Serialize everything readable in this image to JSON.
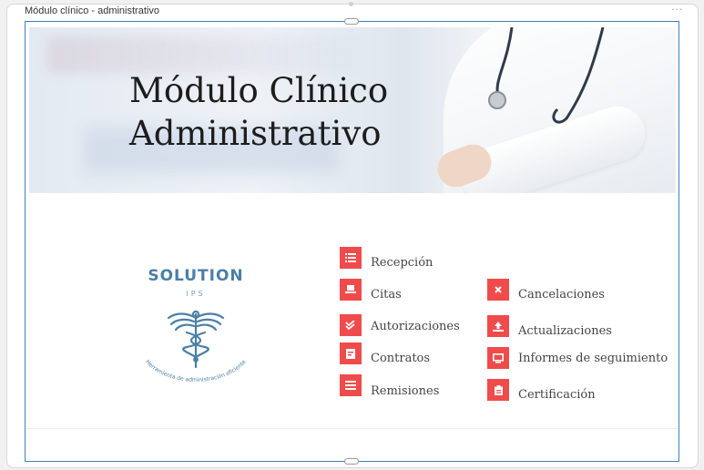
{
  "window": {
    "title": "Módulo clínico - administrativo",
    "more_glyph": "···"
  },
  "banner": {
    "line1": "Módulo Clínico",
    "line2": "Administrativo"
  },
  "logo": {
    "name": "SOLUTION",
    "sub": "IPS",
    "tagline": "Herramienta de administración eficiente"
  },
  "menu": {
    "recepcion": {
      "label": "Recepción",
      "icon": "list-icon"
    },
    "citas": {
      "label": "Citas",
      "icon": "laptop-icon"
    },
    "autorizaciones": {
      "label": "Autorizaciones",
      "icon": "double-check-icon"
    },
    "contratos": {
      "label": "Contratos",
      "icon": "document-icon"
    },
    "remisiones": {
      "label": "Remisiones",
      "icon": "lines-icon"
    },
    "cancelaciones": {
      "label": "Cancelaciones",
      "icon": "close-icon"
    },
    "actualizaciones": {
      "label": "Actualizaciones",
      "icon": "upload-icon"
    },
    "informes": {
      "label": "Informes de seguimiento",
      "icon": "monitor-icon"
    },
    "certificacion": {
      "label": "Certificación",
      "icon": "clipboard-icon"
    }
  },
  "colors": {
    "accent": "#f04b4b",
    "logo": "#4a7fa8",
    "selection": "#3b82c4"
  }
}
